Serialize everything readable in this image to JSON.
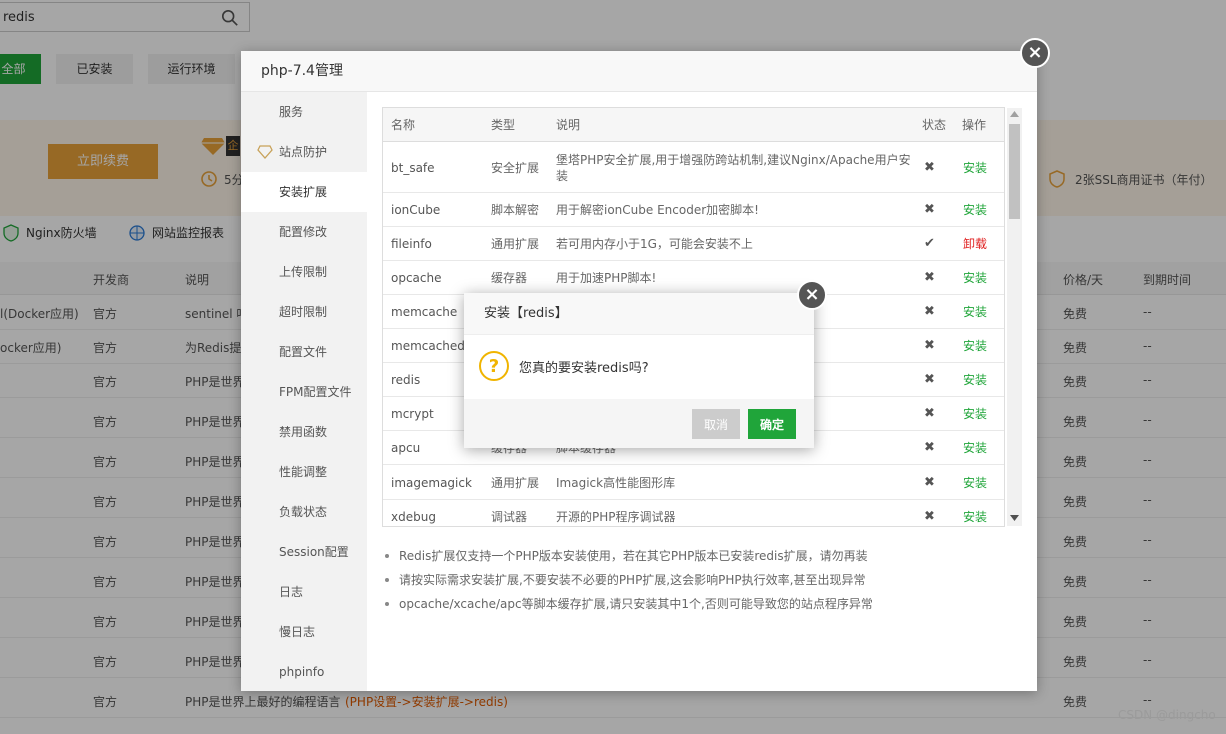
{
  "background": {
    "search": {
      "value": "redis"
    },
    "filters": [
      "全部",
      "已安装",
      "运行环境"
    ],
    "banner": {
      "renew_button": "立即续费",
      "badge_text": "企",
      "countdown_text": "5分",
      "ssl_text": "2张SSL商用证书（年付）"
    },
    "shortcuts": [
      {
        "label": "Nginx防火墙",
        "icon": "shield-icon"
      },
      {
        "label": "网站监控报表",
        "icon": "monitor-icon"
      }
    ],
    "table_headers": {
      "developer": "开发商",
      "description": "说明",
      "price": "价格/天",
      "expire": "到期时间"
    },
    "rows": [
      {
        "name": "l(Docker应用)",
        "developer": "官方",
        "description": "sentinel 哨",
        "price": "免费",
        "expire": "--"
      },
      {
        "name": "ocker应用)",
        "developer": "官方",
        "description": "为Redis提",
        "price": "免费",
        "expire": "--"
      },
      {
        "name": "",
        "developer": "官方",
        "description": "PHP是世界",
        "price": "免费",
        "expire": "--"
      },
      {
        "name": "",
        "developer": "官方",
        "description": "PHP是世界",
        "price": "免费",
        "expire": "--"
      },
      {
        "name": "",
        "developer": "官方",
        "description": "PHP是世界",
        "price": "免费",
        "expire": "--"
      },
      {
        "name": "",
        "developer": "官方",
        "description": "PHP是世界",
        "price": "免费",
        "expire": "--"
      },
      {
        "name": "",
        "developer": "官方",
        "description": "PHP是世界",
        "price": "免费",
        "expire": "--"
      },
      {
        "name": "",
        "developer": "官方",
        "description": "PHP是世界",
        "price": "免费",
        "expire": "--"
      },
      {
        "name": "",
        "developer": "官方",
        "description": "PHP是世界",
        "price": "免费",
        "expire": "--"
      },
      {
        "name": "",
        "developer": "官方",
        "description": "PHP是世界",
        "price": "免费",
        "expire": "--"
      },
      {
        "name": "",
        "developer": "官方",
        "description": "PHP是世界上最好的编程语言",
        "link": "(PHP设置->安装扩展->redis)",
        "price": "免费",
        "expire": "--"
      }
    ]
  },
  "modal": {
    "title": "php-7.4管理",
    "sidebar": [
      "服务",
      "站点防护",
      "安装扩展",
      "配置修改",
      "上传限制",
      "超时限制",
      "配置文件",
      "FPM配置文件",
      "禁用函数",
      "性能调整",
      "负载状态",
      "Session配置",
      "日志",
      "慢日志",
      "phpinfo"
    ],
    "active_index": 2,
    "table_headers": {
      "name": "名称",
      "type": "类型",
      "description": "说明",
      "status": "状态",
      "action": "操作"
    },
    "extensions": [
      {
        "name": "bt_safe",
        "type": "安全扩展",
        "description": "堡塔PHP安全扩展,用于增强防跨站机制,建议Nginx/Apache用户安装",
        "status": "✖",
        "action": "安装"
      },
      {
        "name": "ionCube",
        "type": "脚本解密",
        "description": "用于解密ionCube Encoder加密脚本!",
        "status": "✖",
        "action": "安装"
      },
      {
        "name": "fileinfo",
        "type": "通用扩展",
        "description": "若可用内存小于1G，可能会安装不上",
        "status": "✔",
        "action": "卸载"
      },
      {
        "name": "opcache",
        "type": "缓存器",
        "description": "用于加速PHP脚本!",
        "status": "✖",
        "action": "安装"
      },
      {
        "name": "memcache",
        "type": "",
        "description": "",
        "status": "✖",
        "action": "安装"
      },
      {
        "name": "memcached",
        "type": "",
        "description": "",
        "status": "✖",
        "action": "安装"
      },
      {
        "name": "redis",
        "type": "",
        "description": "",
        "status": "✖",
        "action": "安装"
      },
      {
        "name": "mcrypt",
        "type": "",
        "description": "",
        "status": "✖",
        "action": "安装"
      },
      {
        "name": "apcu",
        "type": "缓存器",
        "description": "脚本缓存器",
        "status": "✖",
        "action": "安装"
      },
      {
        "name": "imagemagick",
        "type": "通用扩展",
        "description": "Imagick高性能图形库",
        "status": "✖",
        "action": "安装"
      },
      {
        "name": "xdebug",
        "type": "调试器",
        "description": "开源的PHP程序调试器",
        "status": "✖",
        "action": "安装"
      }
    ],
    "notes": [
      "Redis扩展仅支持一个PHP版本安装使用，若在其它PHP版本已安装redis扩展，请勿再装",
      "请按实际需求安装扩展,不要安装不必要的PHP扩展,这会影响PHP执行效率,甚至出现异常",
      "opcache/xcache/apc等脚本缓存扩展,请只安装其中1个,否则可能导致您的站点程序异常"
    ]
  },
  "confirm": {
    "title": "安装【redis】",
    "message": "您真的要安装redis吗?",
    "cancel": "取消",
    "ok": "确定"
  },
  "watermark": "CSDN @dingcho",
  "colors": {
    "accent": "#20a53a",
    "warning": "#e8a13a",
    "danger": "#e02020"
  }
}
